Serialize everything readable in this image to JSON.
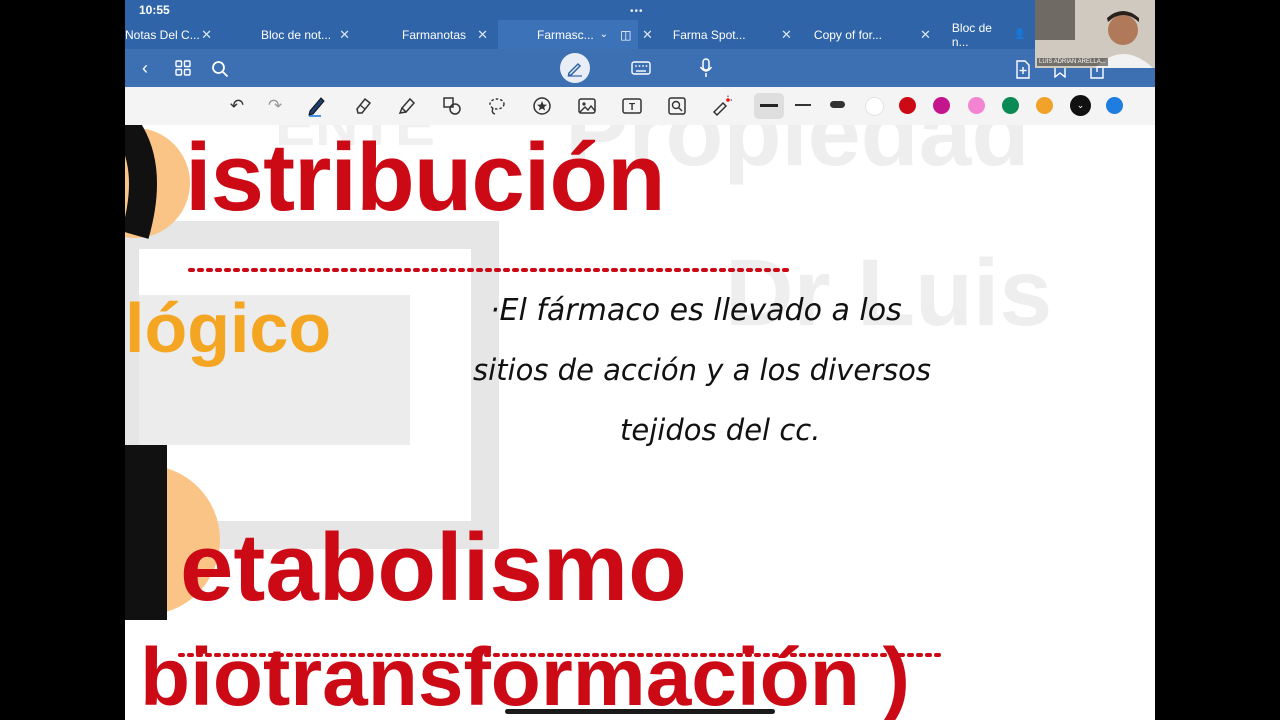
{
  "status": {
    "time": "10:55",
    "dots": "•••"
  },
  "tabs": [
    {
      "label": "Notas Del C..."
    },
    {
      "label": "Bloc de not..."
    },
    {
      "label": "Farmanotas"
    },
    {
      "label": "Farmasc..."
    },
    {
      "label": "Farma Spot..."
    },
    {
      "label": "Copy of for..."
    },
    {
      "label": "Bloc de n..."
    }
  ],
  "icons": {
    "back": "chevron-left-icon",
    "grid": "grid-icon",
    "search": "search-icon",
    "pen_mode": "pen-mode-icon",
    "keyboard": "keyboard-icon",
    "mic": "microphone-icon",
    "add_page": "add-page-icon",
    "bookmark": "bookmark-icon",
    "share": "share-icon"
  },
  "tools": [
    "undo-icon",
    "redo-icon",
    "pen-icon",
    "eraser-icon",
    "highlighter-icon",
    "shapes-icon",
    "lasso-icon",
    "sticker-icon",
    "image-icon",
    "text-icon",
    "camera-icon",
    "laser-pointer-icon"
  ],
  "colors": {
    "tab_bar": "#2f64a8",
    "swatches": [
      "#ffffff",
      "#cc0a16",
      "#c4168c",
      "#f284d2",
      "#0c8a55",
      "#f0a22a",
      "#111111",
      "#1f7ce0"
    ]
  },
  "notes": {
    "heading1": "istribución",
    "heading2": "etabolismo",
    "heading3": "biotransformación )",
    "orange_word": "lógico",
    "line1": "·El fármaco es llevado a los",
    "line2": "sitios de acción y a los diversos",
    "line3": "tejidos del cc."
  },
  "webcam": {
    "name": "LUIS ADRIAN ARELLA..."
  }
}
